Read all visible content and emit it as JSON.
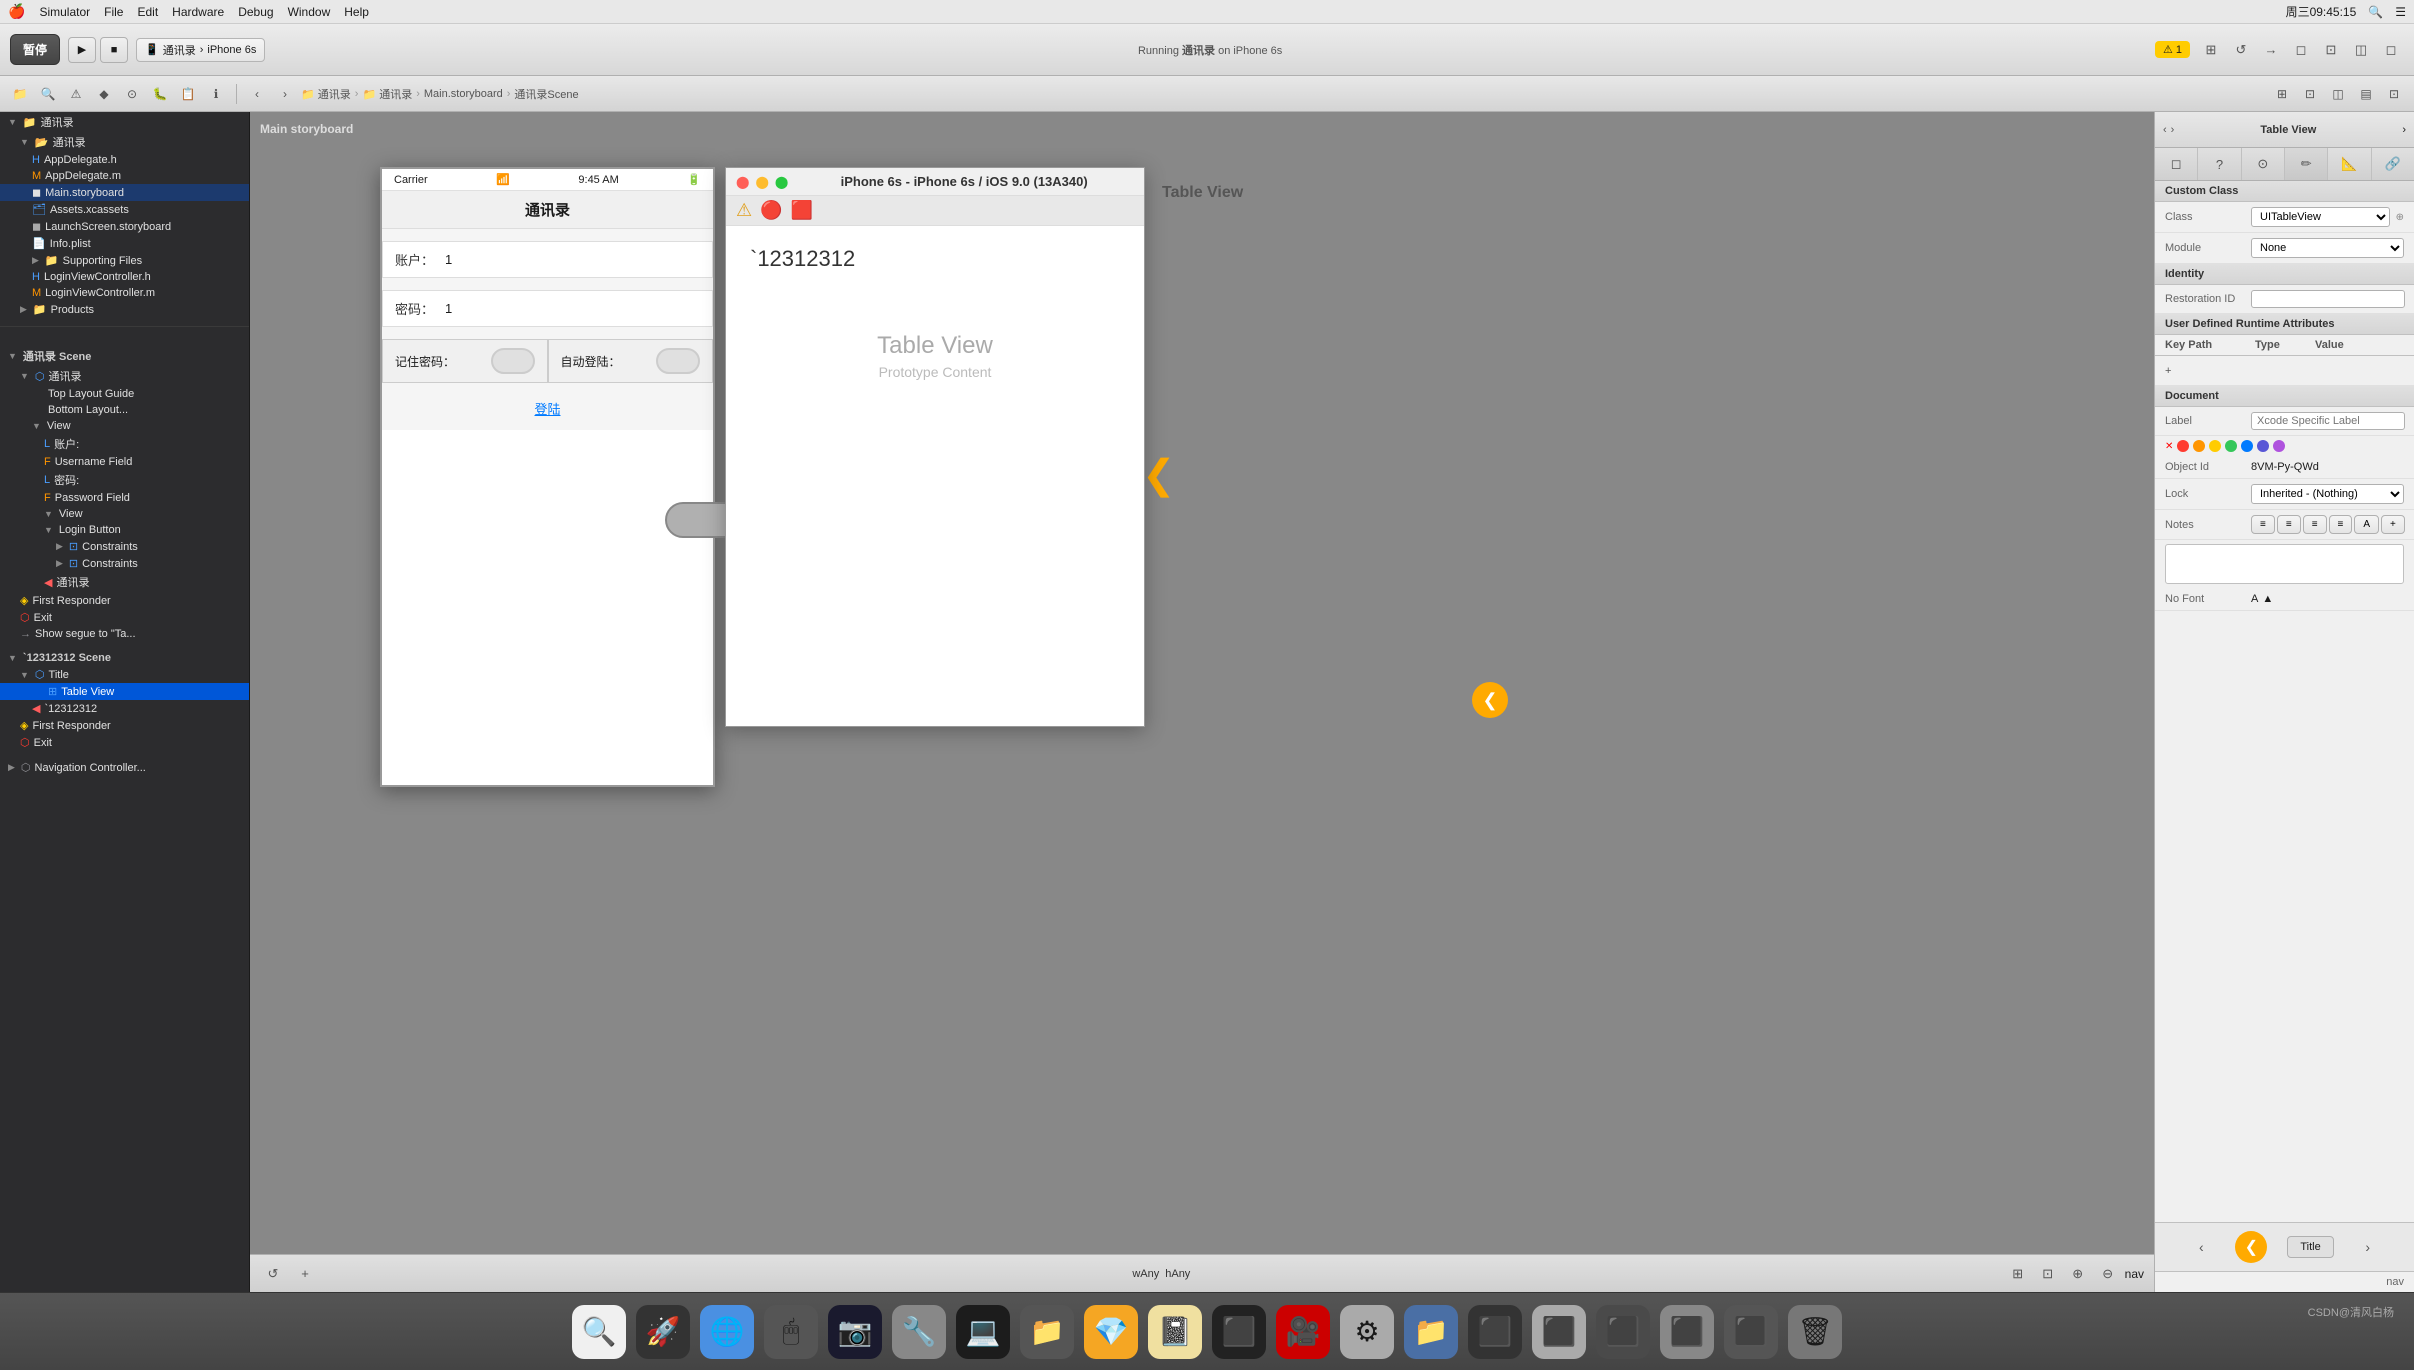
{
  "menubar": {
    "apple": "🍎",
    "items": [
      "Simulator",
      "File",
      "Edit",
      "Hardware",
      "Debug",
      "Window",
      "Help"
    ],
    "right_items": [
      "周三09:45:15",
      "🔍",
      "☰"
    ]
  },
  "toolbar": {
    "pause_label": "暂停",
    "run_icon": "▶",
    "stop_icon": "■",
    "scheme": "通讯录",
    "device": "iPhone 6s",
    "status": "Running 通讯录 on iPhone 6s",
    "warning": "⚠ 1"
  },
  "nav_toolbar": {
    "breadcrumbs": [
      "通讯录",
      "通讯录",
      "Main.storyboard",
      "通讯录Scene"
    ]
  },
  "file_navigator": {
    "root": "通讯录",
    "items": [
      {
        "label": "通讯录",
        "level": 0,
        "icon": "folder",
        "expanded": true
      },
      {
        "label": "通讯录",
        "level": 1,
        "icon": "folder",
        "expanded": true
      },
      {
        "label": "AppDelegate.h",
        "level": 2,
        "icon": "h"
      },
      {
        "label": "AppDelegate.m",
        "level": 2,
        "icon": "m"
      },
      {
        "label": "Main.storyboard",
        "level": 2,
        "icon": "storyboard",
        "selected": true
      },
      {
        "label": "Assets.xcassets",
        "level": 2,
        "icon": "assets"
      },
      {
        "label": "LaunchScreen.storyboard",
        "level": 2,
        "icon": "storyboard"
      },
      {
        "label": "Info.plist",
        "level": 2,
        "icon": "plist"
      },
      {
        "label": "Supporting Files",
        "level": 2,
        "icon": "folder"
      },
      {
        "label": "LoginViewController.h",
        "level": 2,
        "icon": "h"
      },
      {
        "label": "LoginViewController.m",
        "level": 2,
        "icon": "m"
      },
      {
        "label": "Products",
        "level": 1,
        "icon": "folder"
      }
    ]
  },
  "storyboard": {
    "title": "Main storyboard",
    "scenes": [
      {
        "name": "通讯录 Scene",
        "items": [
          "通讯录",
          "Top Layout Guide",
          "Bottom Layout...",
          "View",
          "L 账户:",
          "F Username Field",
          "L 密码:",
          "F Password Field",
          "View",
          "Login Button",
          "Constraints",
          "Constraints",
          "通讯录",
          "First Responder",
          "Exit",
          "Show segue to \"Ta..."
        ]
      },
      {
        "name": "`12312312 Scene",
        "items": [
          "Title",
          "Table View",
          "`12312312",
          "First Responder",
          "Exit"
        ]
      },
      {
        "name": "Navigation Controller..."
      }
    ],
    "phone": {
      "carrier": "Carrier",
      "time": "9:45 AM",
      "title": "通讯录",
      "account_label": "账户：",
      "account_value": "1",
      "password_label": "密码：",
      "password_value": "1",
      "remember_label": "记住密码：",
      "auto_login_label": "自动登陆：",
      "login_link": "登陆"
    },
    "table_view": {
      "title": "Table View",
      "content_label": "Table View",
      "content_sub": "Prototype Content",
      "text": "`12312312"
    }
  },
  "inspector": {
    "title": "Table View",
    "tabs": [
      "◻",
      "↔",
      "⊙",
      "✏",
      "📐",
      "🔖"
    ],
    "custom_class": {
      "label": "Custom Class",
      "class_label": "Class",
      "class_value": "UITableView",
      "module_label": "Module",
      "module_value": "None"
    },
    "identity": {
      "label": "Identity",
      "restoration_id_label": "Restoration ID",
      "restoration_id_value": ""
    },
    "user_defined": {
      "label": "User Defined Runtime Attributes",
      "col_key_path": "Key Path",
      "col_type": "Type",
      "col_value": "Value"
    },
    "document": {
      "label": "Document",
      "label_field": "Label",
      "label_placeholder": "Xcode Specific Label",
      "object_id_label": "Object Id",
      "object_id_value": "8VM-Py-QWd",
      "lock_label": "Lock",
      "lock_value": "Inherited - (Nothing)",
      "notes_label": "Notes",
      "font_label": "No Font"
    },
    "colors": [
      "#ff3b30",
      "#ff9500",
      "#ffcc00",
      "#34c759",
      "#007aff",
      "#5856d6",
      "#af52de"
    ],
    "bottom_buttons": [
      "◻",
      "↺",
      "⊙",
      "⤢"
    ]
  },
  "bottom_bar": {
    "wany": "wAny",
    "hany": "hAny",
    "zoom_icons": [
      "⊞",
      "⊡"
    ],
    "nav_label": "nav"
  },
  "dock": {
    "apps": [
      "🔍",
      "🚀",
      "🌐",
      "🖱",
      "📷",
      "🔧",
      "💻",
      "📁",
      "💎",
      "📓",
      "⬛",
      "🎥",
      "⚙",
      "📁",
      "⬛",
      "🗑"
    ]
  },
  "watermark": "CSDN@清风白杨"
}
